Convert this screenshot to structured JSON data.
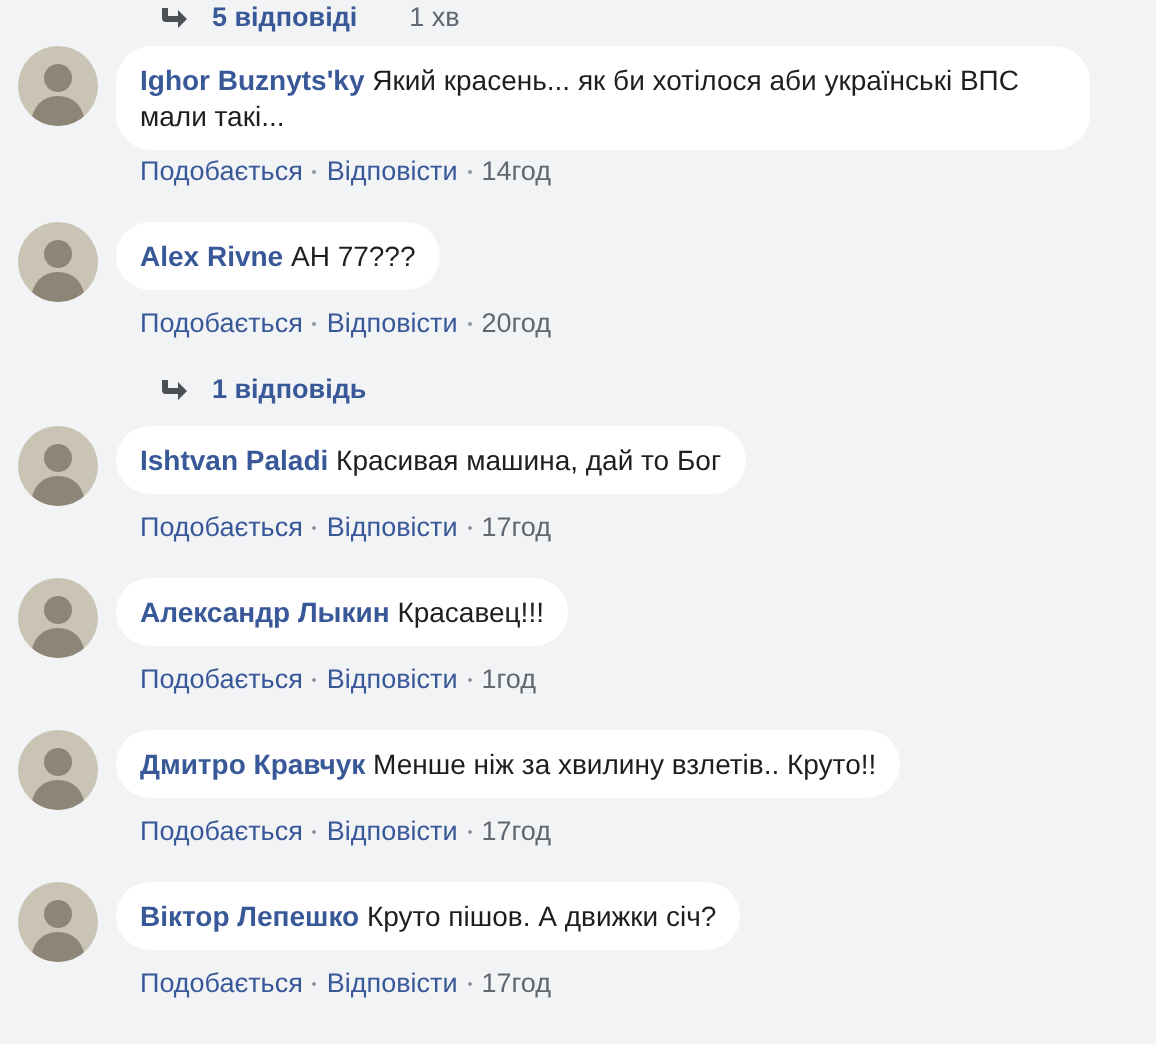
{
  "thread": [
    {
      "kind": "replies",
      "label": "5 відповіді",
      "time": "1 хв"
    },
    {
      "kind": "comment",
      "author": "Ighor Buznyts'ky",
      "text": "Який красень... як би хотілося аби українські ВПС мали такі...",
      "like": "Подобається",
      "reply": "Відповісти",
      "time": "14год"
    },
    {
      "kind": "comment",
      "author": "Alex Rivne",
      "text": "АН 77???",
      "like": "Подобається",
      "reply": "Відповісти",
      "time": "20год"
    },
    {
      "kind": "replies",
      "label": "1 відповідь"
    },
    {
      "kind": "comment",
      "author": "Ishtvan Paladi",
      "text": "Красивая машина, дай то Бог",
      "like": "Подобається",
      "reply": "Відповісти",
      "time": "17год"
    },
    {
      "kind": "comment",
      "author": "Александр Лыкин",
      "text": "Красавец!!!",
      "like": "Подобається",
      "reply": "Відповісти",
      "time": "1год"
    },
    {
      "kind": "comment",
      "author": "Дмитро Кравчук",
      "text": "Менше ніж за хвилину взлетів.. Круто!!",
      "like": "Подобається",
      "reply": "Відповісти",
      "time": "17год"
    },
    {
      "kind": "comment",
      "author": "Віктор Лепешко",
      "text": "Круто пішов. А движки січ?",
      "like": "Подобається",
      "reply": "Відповісти",
      "time": "17год"
    }
  ]
}
